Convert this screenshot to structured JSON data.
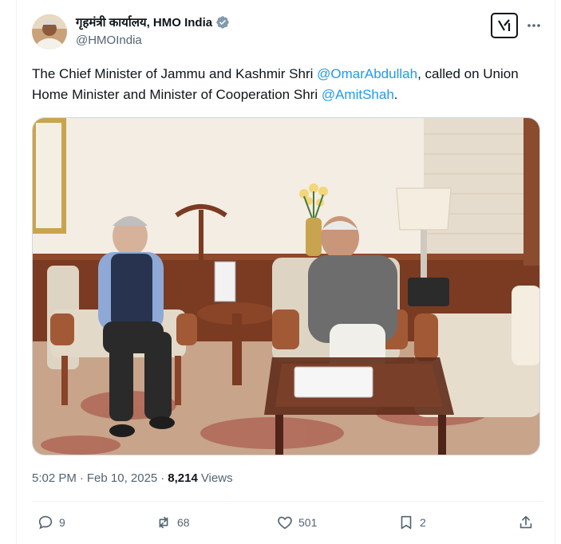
{
  "author": {
    "display_name": "गृहमंत्री कार्यालय, HMO India",
    "handle": "@HMOIndia",
    "verified": true,
    "verified_color": "#829aab"
  },
  "tweet": {
    "text_1": "The Chief Minister of Jammu and Kashmir Shri ",
    "mention_1": "@OmarAbdullah",
    "text_2": ", called on Union Home Minister and Minister of Cooperation Shri ",
    "mention_2": "@AmitShah",
    "text_3": ".",
    "link_color": "#1d9bf0"
  },
  "meta": {
    "time": "5:02 PM",
    "separator": "·",
    "date": "Feb 10, 2025",
    "views_count": "8,214",
    "views_label": "Views"
  },
  "actions": {
    "replies": "9",
    "reposts": "68",
    "likes": "501",
    "bookmarks": "2"
  },
  "icons": {
    "grok": "grok-icon",
    "more": "more-icon",
    "reply": "reply-icon",
    "repost": "repost-icon",
    "like": "heart-icon",
    "bookmark": "bookmark-icon",
    "share": "share-icon"
  }
}
